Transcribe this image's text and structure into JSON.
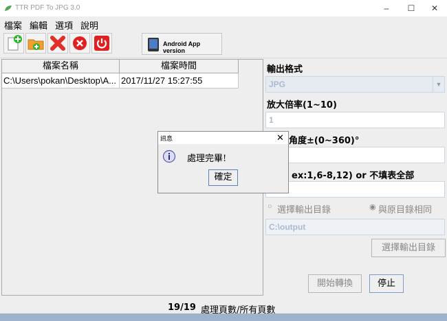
{
  "window": {
    "title": "TTR PDF To JPG 3.0"
  },
  "menu": [
    "檔案",
    "編輯",
    "選項",
    "說明"
  ],
  "toolbar": {
    "android_label": "Android App version"
  },
  "table": {
    "headers": [
      "檔案名稱",
      "檔案時間"
    ],
    "rows": [
      [
        "C:\\Users\\pokan\\Desktop\\A...",
        "2017/11/27 15:27:55"
      ]
    ]
  },
  "panel": {
    "output_format_label": "輸出格式",
    "output_format_value": "JPG",
    "zoom_label": "放大倍率(1~10)",
    "zoom_value": "1",
    "rotate_label": "角度±(0~360)°",
    "pages_label": "ex:1,6-8,12) or 不填表全部",
    "radio_choose": "選擇輸出目錄",
    "radio_same": "與原目錄相同",
    "output_dir_value": "C:\\output",
    "choose_dir_button": "選擇輸出目錄",
    "start_button": "開始轉換",
    "stop_button": "停止"
  },
  "status": {
    "count": "19/19",
    "label": "處理頁數/所有頁數"
  },
  "dialog": {
    "title": "訊息",
    "message": "處理完畢!",
    "ok_button": "確定"
  },
  "colors": {
    "accent_blue": "#9fb2cc",
    "disabled_text": "#a9bad0"
  }
}
